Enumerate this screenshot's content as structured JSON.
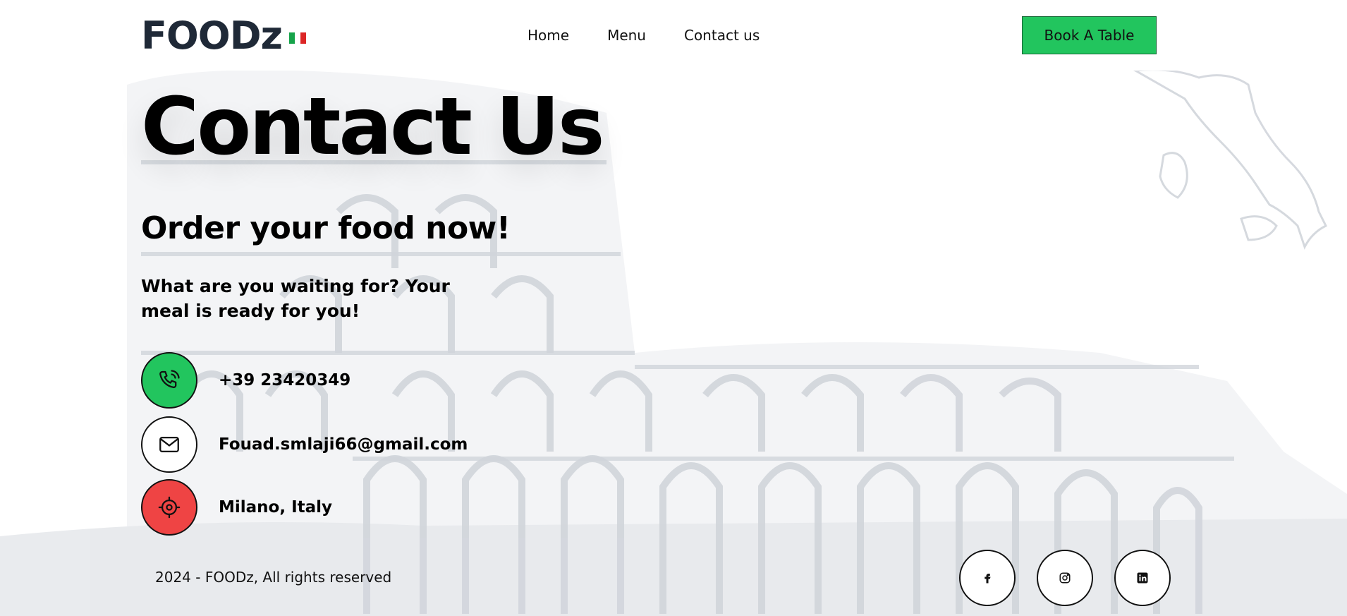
{
  "header": {
    "logo": "FOODz",
    "nav": [
      "Home",
      "Menu",
      "Contact us"
    ],
    "cta": "Book A Table"
  },
  "main": {
    "title": "Contact Us",
    "subtitle": "Order your food now!",
    "lead": "What are you waiting for? Your meal is ready for you!",
    "contacts": [
      {
        "icon": "phone-icon",
        "text": "+39 23420349",
        "color": "#22c55e"
      },
      {
        "icon": "mail-icon",
        "text": "Fouad.smlaji66@gmail.com",
        "color": "#ffffff"
      },
      {
        "icon": "location-icon",
        "text": "Milano, Italy",
        "color": "#ef4444"
      }
    ]
  },
  "footer": {
    "copyright": "2024 - FOODz, All rights reserved",
    "socials": [
      "facebook-icon",
      "instagram-icon",
      "linkedin-icon"
    ]
  },
  "colors": {
    "accent_green": "#22c55e",
    "accent_red": "#ef4444",
    "flag": [
      "#16a34a",
      "#ffffff",
      "#dc2626"
    ]
  }
}
